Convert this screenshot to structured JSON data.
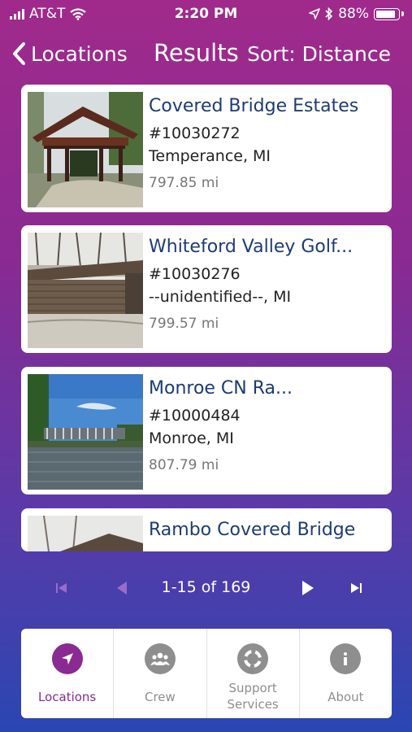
{
  "status": {
    "carrier": "AT&T",
    "time": "2:20 PM",
    "battery": "88%"
  },
  "nav": {
    "back_label": "Locations",
    "title": "Results",
    "sort_label": "Sort: Distance"
  },
  "results": [
    {
      "name": "Covered Bridge Estates",
      "id": "#10030272",
      "location": "Temperance, MI",
      "distance": "797.85 mi"
    },
    {
      "name": "Whiteford Valley Golf...",
      "id": "#10030276",
      "location": "--unidentified--, MI",
      "distance": "799.57 mi"
    },
    {
      "name": "Monroe CN Ra...",
      "id": "#10000484",
      "location": "Monroe, MI",
      "distance": "807.79 mi"
    },
    {
      "name": "Rambo Covered Bridge"
    }
  ],
  "pagination": {
    "range": "1-15 of 169"
  },
  "tabs": [
    {
      "label": "Locations",
      "icon": "location-arrow-icon",
      "active": true
    },
    {
      "label": "Crew",
      "icon": "group-icon"
    },
    {
      "label_line1": "Support",
      "label_line2": "Services",
      "icon": "lifebuoy-icon"
    },
    {
      "label": "About",
      "icon": "info-icon"
    }
  ],
  "colors": {
    "accent": "#8a2a92",
    "title_blue": "#1c3c74",
    "inactive_gray": "#8e8e8e"
  }
}
